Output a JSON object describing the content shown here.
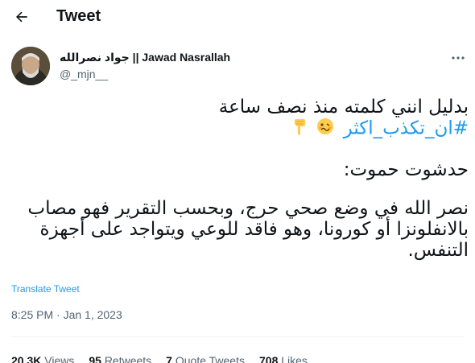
{
  "header": {
    "back_icon": "arrow-left-icon",
    "title": "Tweet"
  },
  "author": {
    "avatar_icon": "avatar-photo",
    "name": "جواد نصرالله || Jawad Nasrallah",
    "handle": "@_mjn__",
    "more_icon": "more-dots-icon"
  },
  "tweet": {
    "line1": "بدليل انني كلمته منذ نصف ساعة",
    "hashtag": "#ان_تكذب_اكثر",
    "emojis": [
      "woozy-face-emoji",
      "point-down-emoji"
    ],
    "line3": "حدشوت حموت:",
    "paragraph": "نصر الله في وضع صحي حرج، وبحسب التقرير فهو مصاب بالانفلونزا أو كورونا، وهو فاقد للوعي ويتواجد على أجهزة التنفس."
  },
  "translate_label": "Translate Tweet",
  "timestamp": "8:25 PM · Jan 1, 2023",
  "stats": {
    "views_count": "20.3K",
    "views_label": "Views",
    "retweets_count": "95",
    "retweets_label": "Retweets",
    "quotes_count": "7",
    "quotes_label": "Quote Tweets",
    "likes_count": "708",
    "likes_label": "Likes"
  },
  "colors": {
    "accent": "#1d9bf0",
    "text": "#0f1419",
    "muted": "#536471"
  }
}
